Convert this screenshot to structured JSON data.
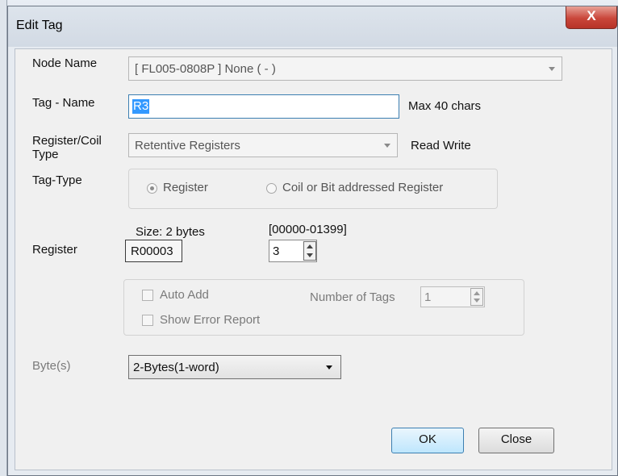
{
  "dialog": {
    "title": "Edit Tag",
    "close_glyph": "X"
  },
  "node_name": {
    "label": "Node Name",
    "value": "[ FL005-0808P ] None ( - )"
  },
  "tag_name": {
    "label": "Tag - Name",
    "value": "R3",
    "hint": "Max 40 chars"
  },
  "register_type": {
    "label": "Register/Coil Type",
    "value": "Retentive Registers",
    "access": "Read Write"
  },
  "tag_type": {
    "label": "Tag-Type",
    "option_register": "Register",
    "option_coil": "Coil or Bit addressed Register",
    "selected": "Register"
  },
  "register": {
    "label": "Register",
    "size": "Size: 2 bytes",
    "range": "[00000-01399]",
    "address": "R00003",
    "number": "3"
  },
  "auto_add": {
    "auto_add_label": "Auto Add",
    "error_report_label": "Show Error Report",
    "num_tags_label": "Number of Tags",
    "num_tags_value": "1"
  },
  "bytes": {
    "label": "Byte(s)",
    "value": "2-Bytes(1-word)"
  },
  "buttons": {
    "ok": "OK",
    "close": "Close"
  },
  "colors": {
    "selection": "#3399ff",
    "focus_border": "#3c7fb1",
    "close_red": "#c9463a"
  }
}
